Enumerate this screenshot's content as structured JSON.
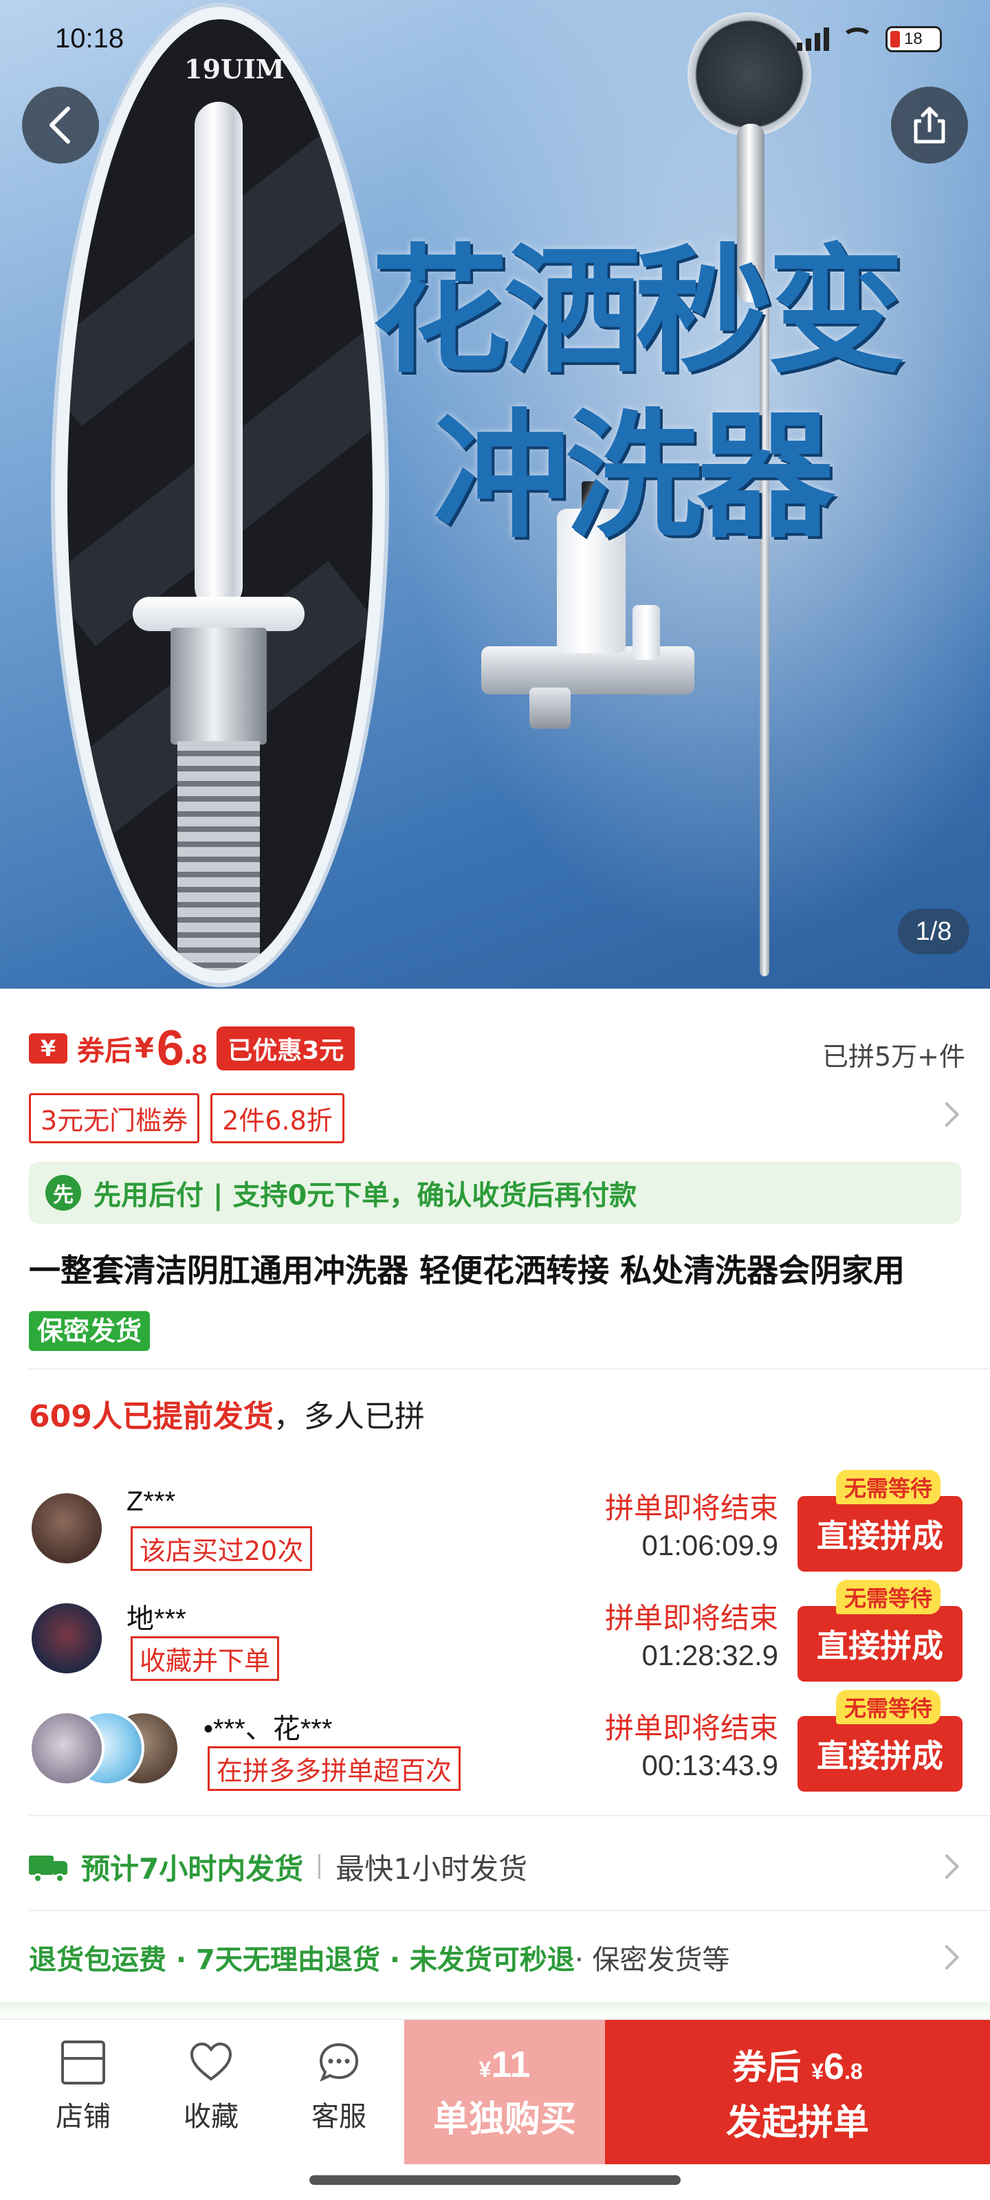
{
  "status_bar": {
    "time": "10:18",
    "battery": "18"
  },
  "hero": {
    "headline_line1": "花洒秒变",
    "headline_line2": "冲洗器",
    "product_label": "19UIM",
    "page_indicator": "1/8"
  },
  "price": {
    "yen_chip": "¥",
    "prefix": "券后",
    "currency": "¥",
    "integer": "6",
    "decimal": ".8",
    "discount_tag": "已优惠3元",
    "sold": "已拼5万+件"
  },
  "coupons": [
    "3元无门槛券",
    "2件6.8折"
  ],
  "pay_after": {
    "icon": "先",
    "text": "先用后付 | 支持0元下单，确认收货后再付款"
  },
  "title": {
    "text": "一整套清洁阴肛通用冲洗器 轻便花洒转接 私处清洗器会阴家用",
    "tag": "保密发货"
  },
  "shipped": {
    "highlight": "609人已提前发货",
    "rest": "，多人已拼"
  },
  "groups": [
    {
      "name": "Z***",
      "tag": "该店买过20次",
      "status": "拼单即将结束",
      "timer": "01:06:09.9",
      "badge": "无需等待",
      "button": "直接拼成"
    },
    {
      "name": "地***",
      "tag": "收藏并下单",
      "status": "拼单即将结束",
      "timer": "01:28:32.9",
      "badge": "无需等待",
      "button": "直接拼成"
    },
    {
      "name": "•***、花***",
      "tag": "在拼多多拼单超百次",
      "status": "拼单即将结束",
      "timer": "00:13:43.9",
      "badge": "无需等待",
      "button": "直接拼成"
    }
  ],
  "shipping": {
    "green": "预计7小时内发货",
    "gray": "最快1小时发货"
  },
  "services": {
    "green": "退货包运费 · 7天无理由退货 · 未发货可秒退",
    "gray": " · 保密发货等"
  },
  "bottom_bar": {
    "store": "店铺",
    "favorite": "收藏",
    "service": "客服",
    "solo_currency": "¥",
    "solo_price": "11",
    "solo_label": "单独购买",
    "group_prefix": "券后",
    "group_currency": "¥",
    "group_int": "6",
    "group_dec": ".8",
    "group_label": "发起拼单"
  },
  "colors": {
    "accent": "#e02e24",
    "green": "#2d9b3a"
  }
}
